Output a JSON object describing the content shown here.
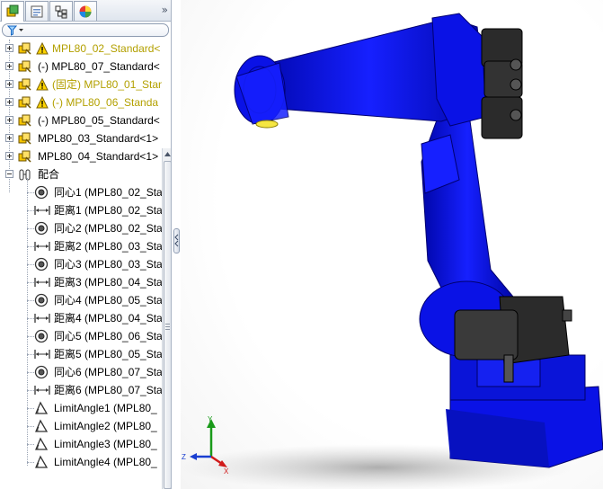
{
  "colors": {
    "robot_blue": "#0a12e6",
    "robot_dark": "#2b2b2b",
    "warning_text": "#b3a000",
    "panel_border": "#a9b4c4"
  },
  "panel_tabs": [
    {
      "name": "featuremanager-tab",
      "icon": "assembly-tree-icon"
    },
    {
      "name": "propertymanager-tab",
      "icon": "property-sheet-icon"
    },
    {
      "name": "configurationmanager-tab",
      "icon": "configuration-icon"
    },
    {
      "name": "appearance-tab",
      "icon": "appearance-sphere-icon"
    }
  ],
  "panel_expand_glyph": "»",
  "tree": {
    "components": [
      {
        "label": "MPL80_02_Standard<",
        "warning": true,
        "prefix": ""
      },
      {
        "label": "(-) MPL80_07_Standard<",
        "warning": false,
        "prefix": ""
      },
      {
        "label": "(固定) MPL80_01_Stan",
        "warning": true,
        "prefix": ""
      },
      {
        "label": "(-) MPL80_06_Standa",
        "warning": true,
        "prefix": ""
      },
      {
        "label": "(-) MPL80_05_Standard<",
        "warning": false,
        "prefix": ""
      },
      {
        "label": "MPL80_03_Standard<1>",
        "warning": false,
        "prefix": ""
      },
      {
        "label": "MPL80_04_Standard<1>",
        "warning": false,
        "prefix": ""
      }
    ],
    "mates_folder": "配合",
    "mates": [
      {
        "type": "concentric",
        "label": "同心1 (MPL80_02_Star"
      },
      {
        "type": "distance",
        "label": "距离1 (MPL80_02_Star"
      },
      {
        "type": "concentric",
        "label": "同心2 (MPL80_02_Star"
      },
      {
        "type": "distance",
        "label": "距离2 (MPL80_03_Star"
      },
      {
        "type": "concentric",
        "label": "同心3 (MPL80_03_Star"
      },
      {
        "type": "distance",
        "label": "距离3 (MPL80_04_Star"
      },
      {
        "type": "concentric",
        "label": "同心4 (MPL80_05_Star"
      },
      {
        "type": "distance",
        "label": "距离4 (MPL80_04_Star"
      },
      {
        "type": "concentric",
        "label": "同心5 (MPL80_06_Star"
      },
      {
        "type": "distance",
        "label": "距离5 (MPL80_05_Star"
      },
      {
        "type": "concentric",
        "label": "同心6 (MPL80_07_Star"
      },
      {
        "type": "distance",
        "label": "距离6 (MPL80_07_Star"
      },
      {
        "type": "angle",
        "label": "LimitAngle1 (MPL80_"
      },
      {
        "type": "angle",
        "label": "LimitAngle2 (MPL80_"
      },
      {
        "type": "angle",
        "label": "LimitAngle3 (MPL80_"
      },
      {
        "type": "angle",
        "label": "LimitAngle4 (MPL80_"
      }
    ]
  },
  "triad": {
    "x_label": "X",
    "y_label": "Y",
    "z_label": "Z"
  }
}
